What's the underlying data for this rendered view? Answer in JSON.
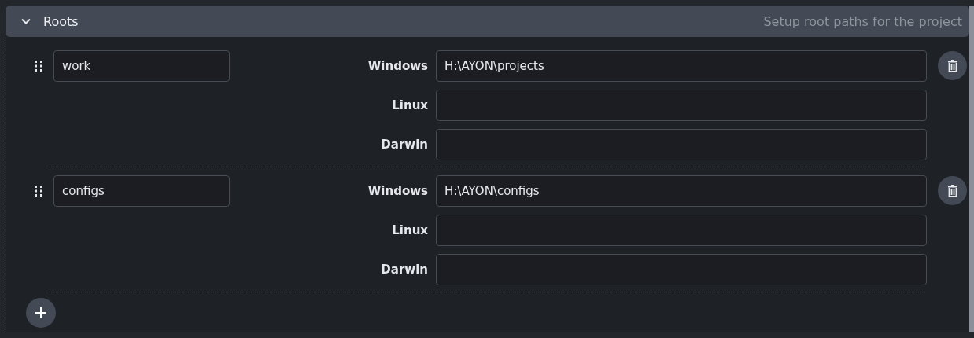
{
  "section": {
    "title": "Roots",
    "description": "Setup root paths for the project",
    "expanded": true
  },
  "roots": [
    {
      "name": "work",
      "paths": [
        {
          "label": "Windows",
          "value": "H:\\AYON\\projects"
        },
        {
          "label": "Linux"
        },
        {
          "label": "Darwin"
        }
      ]
    },
    {
      "name": "configs",
      "paths": [
        {
          "label": "Windows",
          "value": "H:\\AYON\\configs"
        },
        {
          "label": "Linux"
        },
        {
          "label": "Darwin"
        }
      ]
    }
  ]
}
